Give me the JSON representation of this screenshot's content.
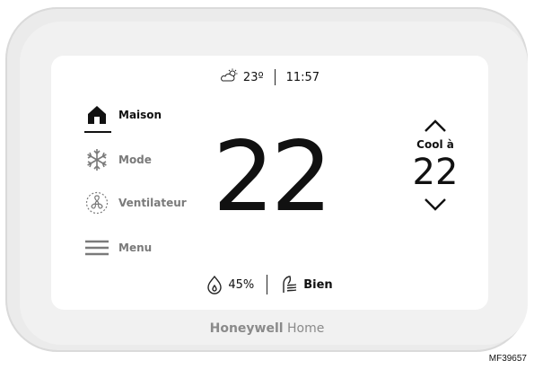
{
  "status_bar": {
    "temperature": "23º",
    "time": "11:57",
    "weather_icon": "partly-cloudy-icon"
  },
  "nav": [
    {
      "label": "Maison",
      "icon": "home-icon",
      "active": true
    },
    {
      "label": "Mode",
      "icon": "snowflake-icon",
      "active": false
    },
    {
      "label": "Ventilateur",
      "icon": "fan-icon",
      "active": false
    },
    {
      "label": "Menu",
      "icon": "menu-icon",
      "active": false
    }
  ],
  "main": {
    "current_temperature": "22"
  },
  "setpoint": {
    "label": "Cool à",
    "value": "22"
  },
  "bottom": {
    "humidity": "45%",
    "air_quality": "Bien"
  },
  "brand": {
    "name_bold": "Honeywell",
    "name_light": "Home"
  },
  "figure_code": "MF39657",
  "colors": {
    "text": "#111111",
    "muted": "#7a7a7a",
    "bezel": "#ebebeb"
  }
}
